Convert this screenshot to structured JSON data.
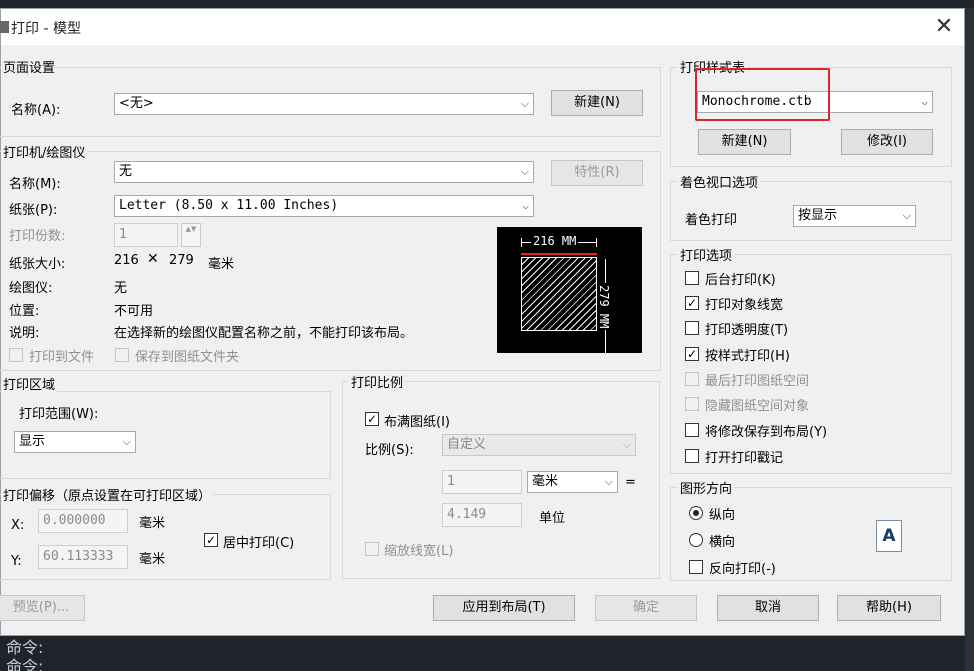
{
  "window": {
    "title": "打印 - 模型",
    "close_glyph": "✕"
  },
  "page_setup": {
    "group": "页面设置",
    "name_label": "名称(A):",
    "name_value": "<无>",
    "new_button": "新建(N)"
  },
  "printer": {
    "group": "打印机/绘图仪",
    "name_label": "名称(M):",
    "name_value": "无",
    "properties_button": "特性(R)",
    "paper_label": "纸张(P):",
    "paper_value": "Letter (8.50 x 11.00 Inches)",
    "copies_label": "打印份数:",
    "copies_value": "1",
    "size_label": "纸张大小:",
    "size_w": "216",
    "size_x": "✕",
    "size_h": "279",
    "size_unit": "毫米",
    "plotter_label": "绘图仪:",
    "plotter_value": "无",
    "location_label": "位置:",
    "location_value": "不可用",
    "desc_label": "说明:",
    "desc_value": "在选择新的绘图仪配置名称之前，不能打印该布局。",
    "print_to_file": "打印到文件",
    "save_to_paper": "保存到图纸文件夹",
    "preview_w": "216 MM",
    "preview_h": "279 MM"
  },
  "plot_area": {
    "group": "打印区域",
    "range_label": "打印范围(W):",
    "range_value": "显示"
  },
  "plot_offset": {
    "group": "打印偏移（原点设置在可打印区域）",
    "x_label": "X:",
    "x_value": "0.000000",
    "x_unit": "毫米",
    "y_label": "Y:",
    "y_value": "60.113333",
    "y_unit": "毫米",
    "center": "居中打印(C)"
  },
  "plot_scale": {
    "group": "打印比例",
    "fit": "布满图纸(I)",
    "scale_label": "比例(S):",
    "scale_value": "自定义",
    "num_value": "1",
    "unit_value": "毫米",
    "equals": "=",
    "den_value": "4.149",
    "den_unit": "单位",
    "scale_lineweight": "缩放线宽(L)"
  },
  "style_table": {
    "group": "打印样式表",
    "value": "Monochrome.ctb",
    "new_button": "新建(N)",
    "edit_button": "修改(I)"
  },
  "shaded": {
    "group": "着色视口选项",
    "label": "着色打印",
    "value": "按显示"
  },
  "options": {
    "group": "打印选项",
    "background": "后台打印(K)",
    "lineweights": "打印对象线宽",
    "transparency": "打印透明度(T)",
    "styles": "按样式打印(H)",
    "paperspace_last": "最后打印图纸空间",
    "hide_objects": "隐藏图纸空间对象",
    "save_changes": "将修改保存到布局(Y)",
    "stamp": "打开打印戳记"
  },
  "orientation": {
    "group": "图形方向",
    "portrait": "纵向",
    "landscape": "横向",
    "reverse": "反向打印(-)",
    "icon_letter": "A"
  },
  "footer": {
    "preview": "预览(P)...",
    "apply": "应用到布局(T)",
    "ok": "确定",
    "cancel": "取消",
    "help": "帮助(H)"
  },
  "command": {
    "line1": "命令:",
    "line2": "命令:"
  },
  "glyphs": {
    "arrow": "⌵",
    "check": "✓",
    "spin": "▲▼"
  },
  "colors": {
    "highlight": "#e0242c"
  }
}
